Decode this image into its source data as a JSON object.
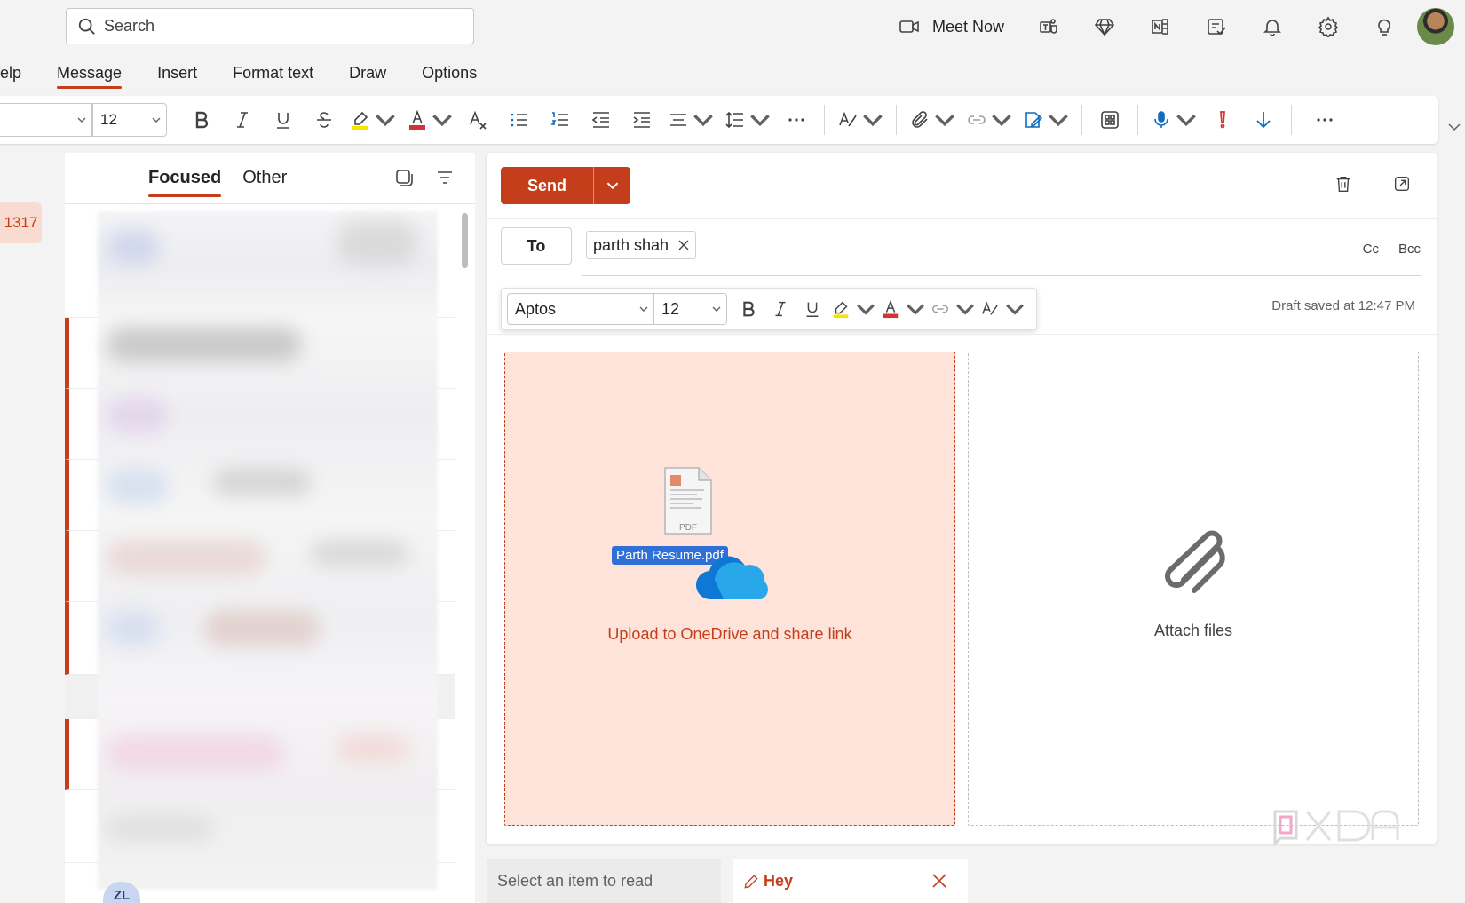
{
  "search": {
    "placeholder": "Search"
  },
  "top_bar": {
    "meet_now_label": "Meet Now",
    "icons": [
      "video-icon",
      "teams-icon",
      "premium-diamond-icon",
      "onenote-icon",
      "todo-icon",
      "bell-icon",
      "gear-icon",
      "lightbulb-icon"
    ]
  },
  "ribbon_tabs": [
    {
      "label": "elp"
    },
    {
      "label": "Message",
      "active": true
    },
    {
      "label": "Insert"
    },
    {
      "label": "Format text"
    },
    {
      "label": "Draw"
    },
    {
      "label": "Options"
    }
  ],
  "ribbon": {
    "font_size": "12"
  },
  "left_strip": {
    "count": "1317"
  },
  "message_list": {
    "pivots": [
      {
        "label": "Focused",
        "active": true
      },
      {
        "label": "Other"
      }
    ],
    "partial_avatar_initials": "ZL"
  },
  "compose": {
    "send_label": "Send",
    "to_label": "To",
    "recipient": "parth shah",
    "cc_label": "Cc",
    "bcc_label": "Bcc",
    "format": {
      "font": "Aptos",
      "size": "12"
    },
    "draft_status": "Draft saved at 12:47 PM",
    "drop_onedrive": {
      "file_name": "Parth Resume.pdf",
      "file_type_label": "PDF",
      "text": "Upload to OneDrive and share link"
    },
    "drop_attach": {
      "text": "Attach files"
    }
  },
  "bottom_tabs": {
    "reading": "Select an item to read",
    "draft_tab": "Hey"
  },
  "colors": {
    "accent": "#c43e1c",
    "drop_zone_bg": "#fde3d9",
    "file_label_bg": "#2f6fd6"
  }
}
